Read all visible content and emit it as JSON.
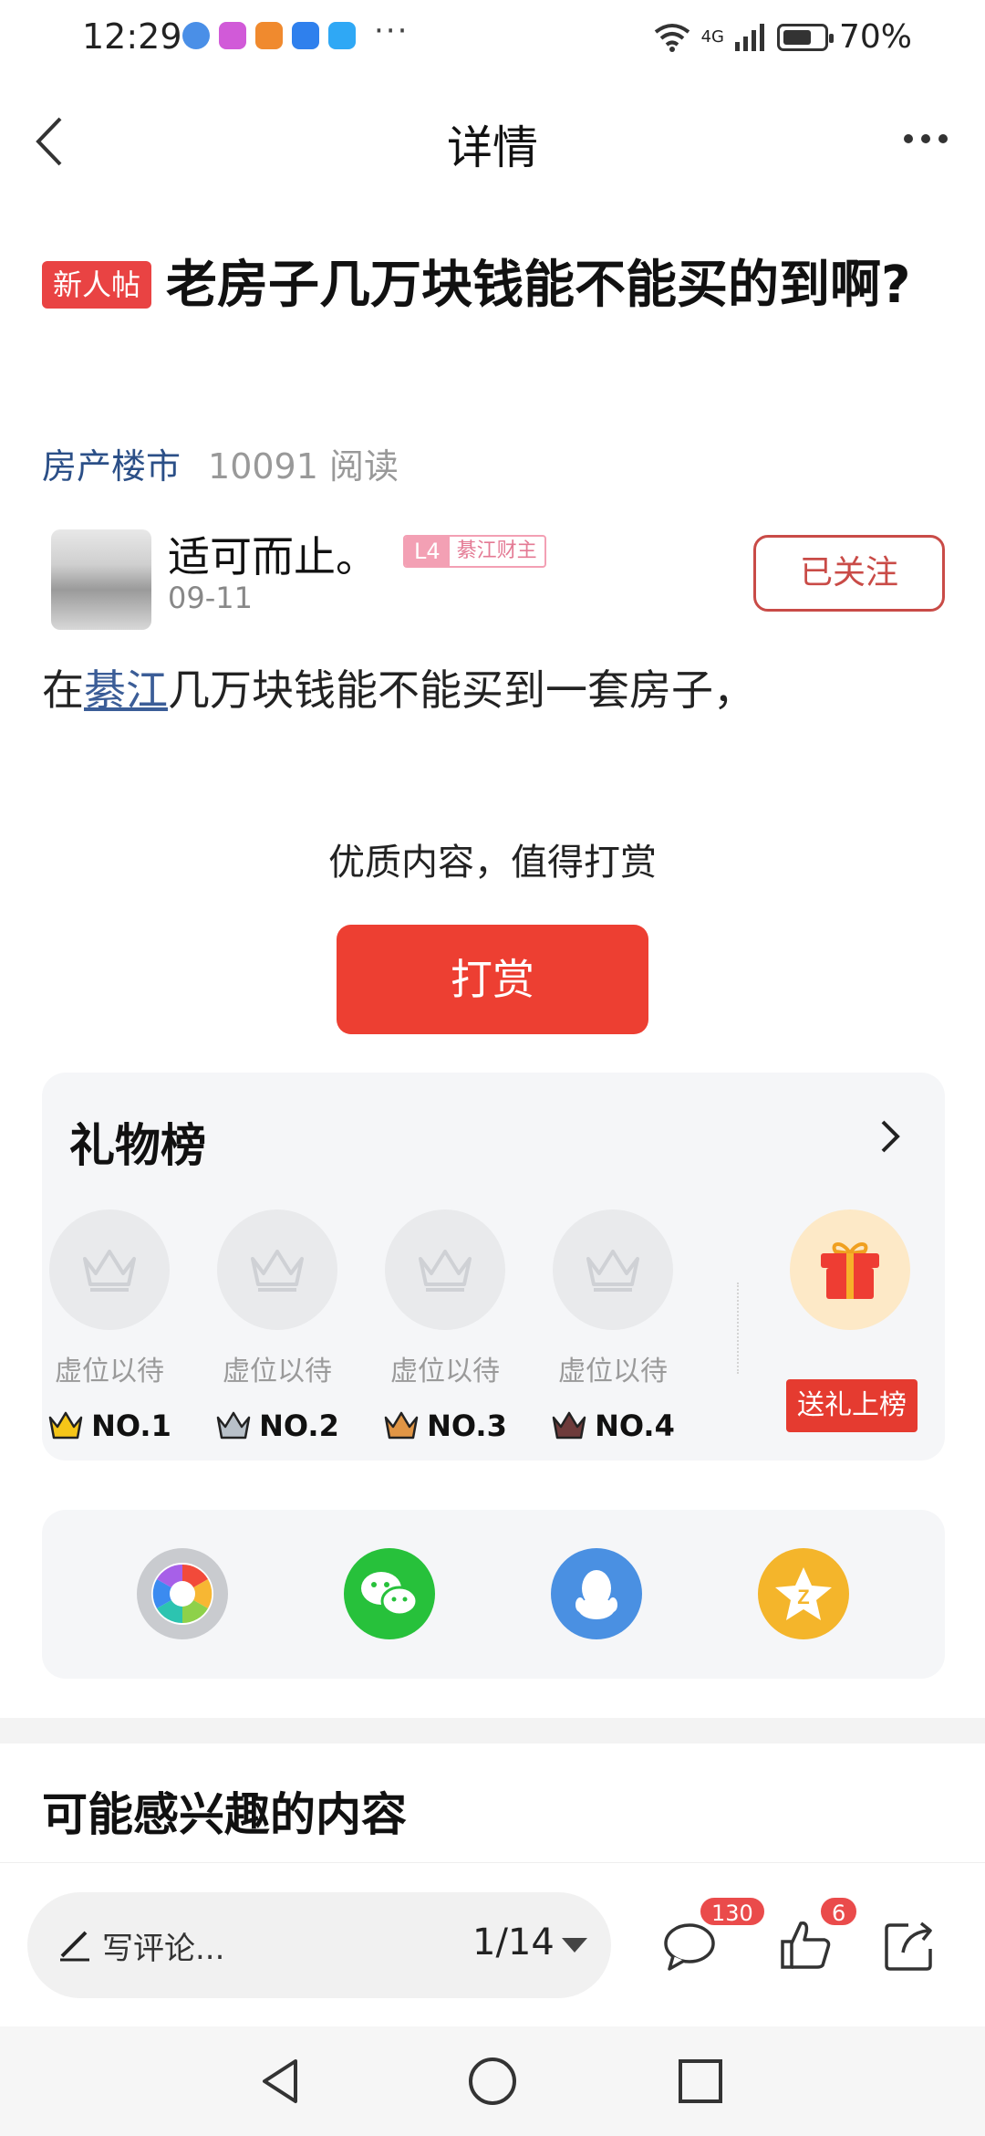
{
  "status_bar": {
    "time": "12:29",
    "more": "···",
    "network": "4G",
    "battery": "70%",
    "app_icon_colors": [
      "#4a8fe7",
      "#f08a2e",
      "#f4b400",
      "#2f80ed",
      "#2fa8f5"
    ]
  },
  "header": {
    "title": "详情"
  },
  "post": {
    "tag": "新人帖",
    "title": "老房子几万块钱能不能买的到啊?",
    "category": "房产楼市",
    "read_count": "10091 阅读",
    "body_prefix": "在",
    "body_link": "綦江",
    "body_suffix": "几万块钱能不能买到一套房子，"
  },
  "author": {
    "name": "适可而止。",
    "level": "L4",
    "level_title": "綦江财主",
    "date": "09-11",
    "follow_label": "已关注"
  },
  "reward": {
    "prompt": "优质内容，值得打赏",
    "button_label": "打赏",
    "accent_color": "#ed3f32"
  },
  "gift_board": {
    "title": "礼物榜",
    "slots": [
      {
        "caption": "虚位以待",
        "rank": "NO.1",
        "crown_color": "#f5c518"
      },
      {
        "caption": "虚位以待",
        "rank": "NO.2",
        "crown_color": "#b8c0c8"
      },
      {
        "caption": "虚位以待",
        "rank": "NO.3",
        "crown_color": "#e09545"
      },
      {
        "caption": "虚位以待",
        "rank": "NO.4",
        "crown_color": "#6e3b3b"
      }
    ],
    "send_label": "送礼上榜"
  },
  "share": {
    "icons": [
      "moments-icon",
      "wechat-icon",
      "qq-icon",
      "qzone-icon"
    ]
  },
  "interest": {
    "title": "可能感兴趣的内容"
  },
  "action_bar": {
    "comment_placeholder": "写评论...",
    "page_indicator": "1/14",
    "comment_count": "130",
    "like_count": "6"
  }
}
